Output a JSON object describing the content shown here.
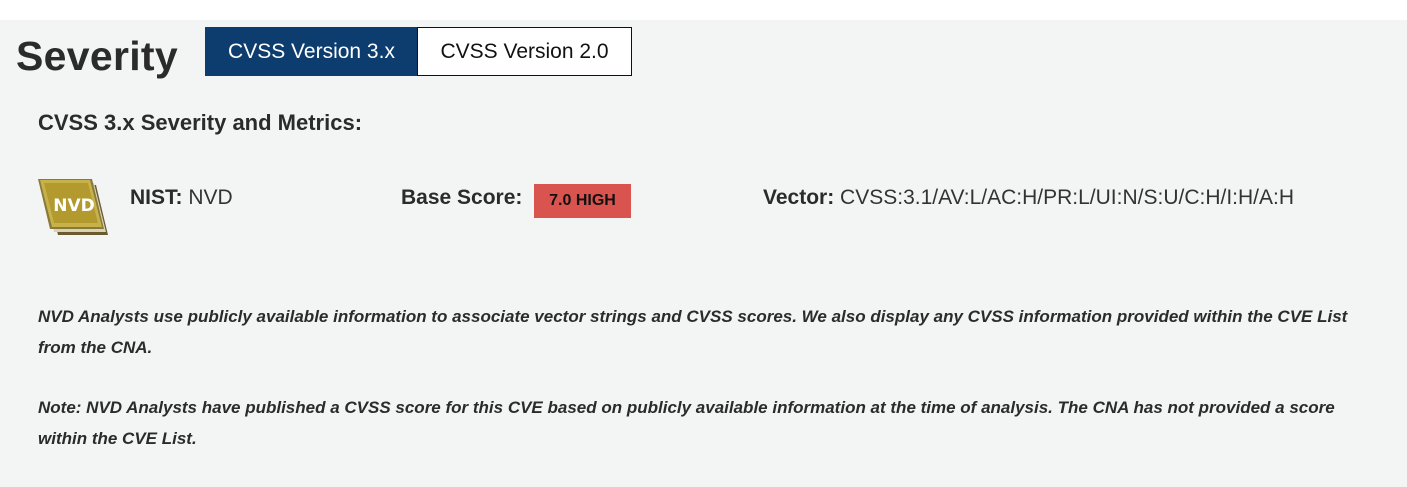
{
  "section": {
    "title": "Severity"
  },
  "tabs": [
    {
      "label": "CVSS Version 3.x",
      "active": true
    },
    {
      "label": "CVSS Version 2.0",
      "active": false
    }
  ],
  "metrics": {
    "heading": "CVSS 3.x Severity and Metrics:",
    "logo_icon": "nvd-logo-icon",
    "logo_text": "NVD",
    "source_label": "NIST:",
    "source_value": "NVD",
    "base_score_label": "Base Score:",
    "base_score_badge": "7.0 HIGH",
    "vector_label": "Vector:",
    "vector_value": "CVSS:3.1/AV:L/AC:H/PR:L/UI:N/S:U/C:H/I:H/A:H",
    "badge_color": "#d9534f"
  },
  "notes": [
    "NVD Analysts use publicly available information to associate vector strings and CVSS scores. We also display any CVSS information provided within the CVE List from the CNA.",
    "Note: NVD Analysts have published a CVSS score for this CVE based on publicly available information at the time of analysis. The CNA has not provided a score within the CVE List."
  ],
  "colors": {
    "tab_active_bg": "#0d3c6e",
    "panel_bg": "#f3f4f4"
  }
}
